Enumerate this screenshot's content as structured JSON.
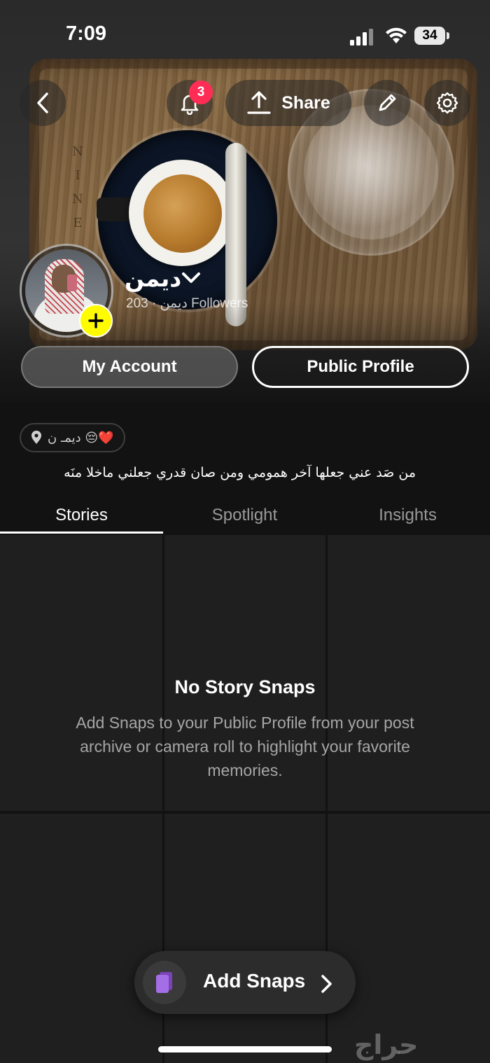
{
  "status_bar": {
    "time": "7:09",
    "battery": "34"
  },
  "header": {
    "notification_count": "3",
    "share_label": "Share"
  },
  "profile": {
    "display_name": "ديمن",
    "username": "ديمن",
    "followers": "203 Followers",
    "separator": "·"
  },
  "account_buttons": {
    "my_account": "My Account",
    "public_profile": "Public Profile"
  },
  "bio": {
    "location_chip": "ديمـ ن 😔❤️",
    "text": "من صَد عني جعلها آخر همومي ومن صان قدري جعلني ماخلا منَه"
  },
  "tabs": [
    {
      "label": "Stories",
      "active": true
    },
    {
      "label": "Spotlight",
      "active": false
    },
    {
      "label": "Insights",
      "active": false
    }
  ],
  "empty_state": {
    "title": "No Story Snaps",
    "description": "Add Snaps to your Public Profile from your post archive or camera roll to highlight your favorite memories."
  },
  "add_snaps": {
    "label": "Add Snaps"
  },
  "watermark": "حراج",
  "colors": {
    "accent_yellow": "#fffc00",
    "badge_red": "#ff2d55",
    "snaps_icon_purple": "#9b59d6",
    "background": "#121212"
  }
}
